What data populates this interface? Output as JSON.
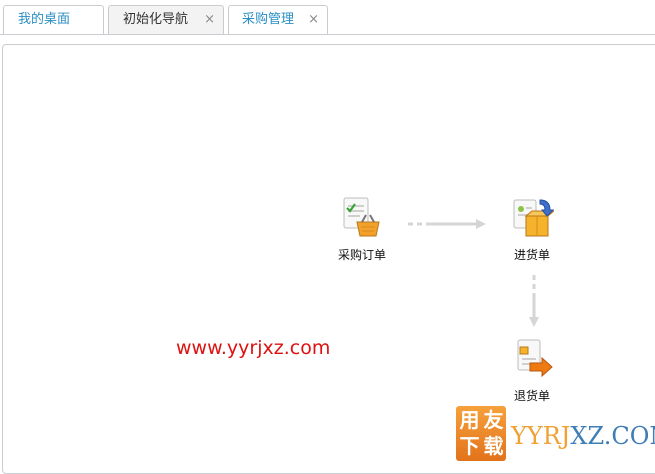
{
  "tabs": [
    {
      "label": "我的桌面",
      "closable": false
    },
    {
      "label": "初始化导航",
      "closable": true,
      "close_icon": "×"
    },
    {
      "label": "采购管理",
      "closable": true,
      "close_icon": "×",
      "active": true
    }
  ],
  "workflow": {
    "nodes": [
      {
        "label": "采购订单",
        "icon": "purchase-order-icon"
      },
      {
        "label": "进货单",
        "icon": "goods-receipt-icon"
      },
      {
        "label": "退货单",
        "icon": "goods-return-icon"
      }
    ]
  },
  "watermark": {
    "url": "www.yyrjxz.com",
    "logo_chars": [
      "用",
      "友",
      "下",
      "载"
    ],
    "logo_text_a": "YYRJ",
    "logo_text_b": "XZ.COM"
  },
  "colors": {
    "tab_active_text": "#2a8fc4",
    "watermark_red": "#dd1111",
    "logo_orange": "#f0a133",
    "logo_blue": "#3f7db5"
  }
}
